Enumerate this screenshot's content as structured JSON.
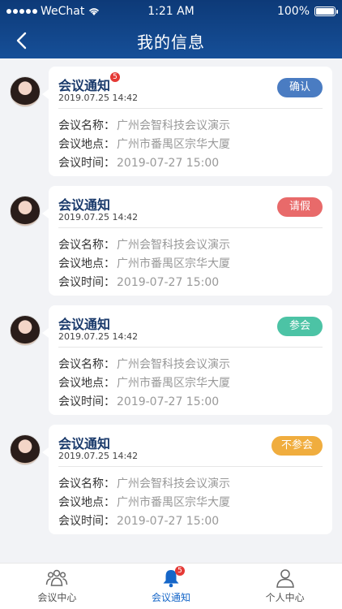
{
  "status_bar": {
    "carrier": "WeChat",
    "time": "1:21 AM",
    "battery": "100%"
  },
  "header": {
    "title": "我的信息"
  },
  "notices": [
    {
      "title": "会议通知",
      "badge": "5",
      "date": "2019.07.25 14:42",
      "status": "确认",
      "status_color": "#4a7cc2",
      "name_label": "会议名称：",
      "name": "广州会智科技会议演示",
      "place_label": "会议地点：",
      "place": "广州市番禺区宗华大厦",
      "time_label": "会议时间：",
      "time": "2019-07-27 15:00"
    },
    {
      "title": "会议通知",
      "badge": "",
      "date": "2019.07.25 14:42",
      "status": "请假",
      "status_color": "#e86a6a",
      "name_label": "会议名称：",
      "name": "广州会智科技会议演示",
      "place_label": "会议地点：",
      "place": "广州市番禺区宗华大厦",
      "time_label": "会议时间：",
      "time": "2019-07-27 15:00"
    },
    {
      "title": "会议通知",
      "badge": "",
      "date": "2019.07.25 14:42",
      "status": "参会",
      "status_color": "#4cc3a5",
      "name_label": "会议名称：",
      "name": "广州会智科技会议演示",
      "place_label": "会议地点：",
      "place": "广州市番禺区宗华大厦",
      "time_label": "会议时间：",
      "time": "2019-07-27 15:00"
    },
    {
      "title": "会议通知",
      "badge": "",
      "date": "2019.07.25 14:42",
      "status": "不参会",
      "status_color": "#f0ad3e",
      "name_label": "会议名称：",
      "name": "广州会智科技会议演示",
      "place_label": "会议地点：",
      "place": "广州市番禺区宗华大厦",
      "time_label": "会议时间：",
      "time": "2019-07-27 15:00"
    }
  ],
  "tabbar": {
    "items": [
      {
        "label": "会议中心",
        "icon": "people-icon",
        "badge": ""
      },
      {
        "label": "会议通知",
        "icon": "bell-icon",
        "badge": "5"
      },
      {
        "label": "个人中心",
        "icon": "person-icon",
        "badge": ""
      }
    ],
    "active_index": 1
  },
  "colors": {
    "nav_bg": "#164f98",
    "accent": "#1566c8",
    "badge": "#e53935"
  }
}
